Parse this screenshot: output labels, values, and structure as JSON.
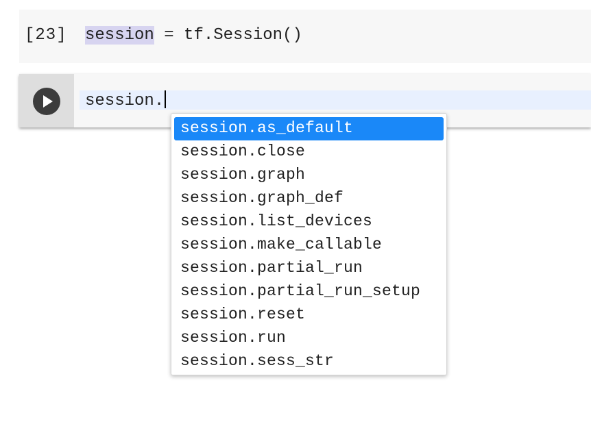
{
  "executed_cell": {
    "execution_count": "[23]",
    "code_highlight": "session",
    "code_rest": " = tf.Session()"
  },
  "active_cell": {
    "run_icon": "play-icon",
    "input_text": "session."
  },
  "autocomplete": {
    "selected_index": 0,
    "items": [
      {
        "label": "session.as_default"
      },
      {
        "label": "session.close"
      },
      {
        "label": "session.graph"
      },
      {
        "label": "session.graph_def"
      },
      {
        "label": "session.list_devices"
      },
      {
        "label": "session.make_callable"
      },
      {
        "label": "session.partial_run"
      },
      {
        "label": "session.partial_run_setup"
      },
      {
        "label": "session.reset"
      },
      {
        "label": "session.run"
      },
      {
        "label": "session.sess_str"
      }
    ]
  },
  "colors": {
    "selection_highlight": "#d7d4f0",
    "selected_item_bg": "#1a88f8",
    "editor_bg": "#e8f0fe",
    "cell_bg": "#f7f7f7",
    "gutter_bg": "#dedede"
  }
}
